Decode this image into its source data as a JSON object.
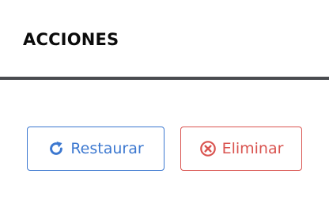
{
  "section": {
    "title": "ACCIONES"
  },
  "actions": {
    "restore": {
      "label": "Restaurar",
      "icon": "refresh-icon",
      "color": "#3c78d0"
    },
    "delete": {
      "label": "Eliminar",
      "icon": "circle-x-icon",
      "color": "#d9534f"
    }
  }
}
